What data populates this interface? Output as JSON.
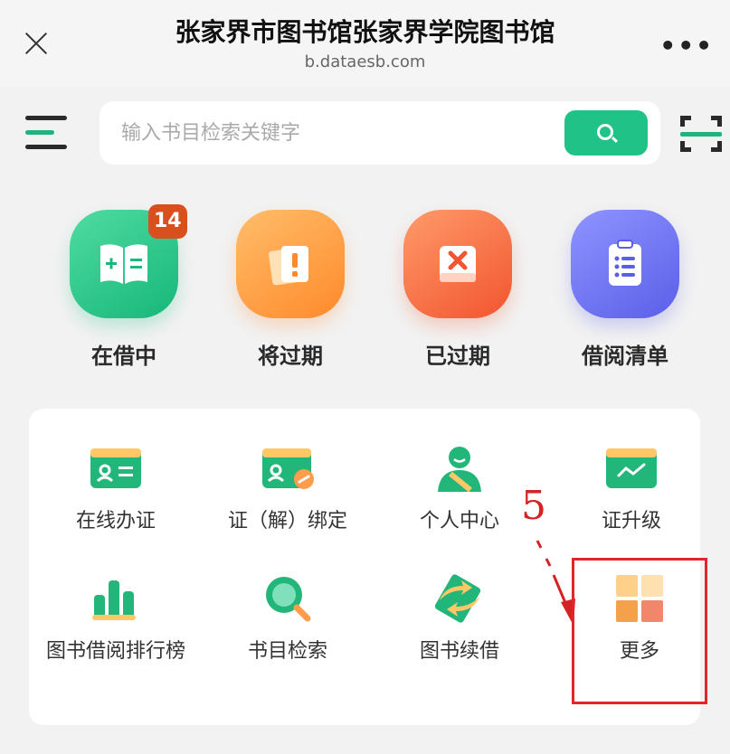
{
  "header": {
    "title": "张家界市图书馆张家界学院图书馆",
    "url": "b.dataesb.com",
    "more": "•••"
  },
  "search": {
    "placeholder": "输入书目检索关键字"
  },
  "features": [
    {
      "label": "在借中",
      "badge": "14"
    },
    {
      "label": "将过期"
    },
    {
      "label": "已过期"
    },
    {
      "label": "借阅清单"
    }
  ],
  "grid": {
    "row1": [
      "在线办证",
      "证（解）绑定",
      "个人中心",
      "证升级"
    ],
    "row2": [
      "图书借阅排行榜",
      "书目检索",
      "图书续借",
      "更多"
    ]
  },
  "annotation": {
    "step": "5"
  },
  "colors": {
    "accent": "#21c288",
    "badge": "#d9501f",
    "highlight": "#e0262a"
  }
}
